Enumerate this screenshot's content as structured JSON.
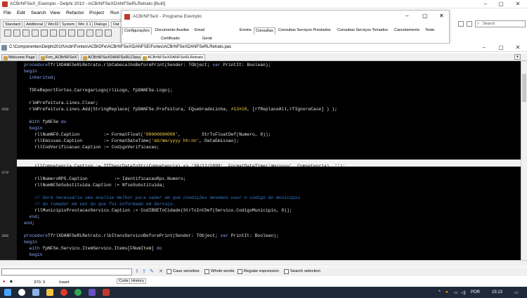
{
  "ide": {
    "title": "ACBrNFSeX_Exemplo - Delphi 2010 - ACBrNFSeXDANFSeRLRetrato [Built]",
    "menu": [
      "File",
      "Edit",
      "Search",
      "View",
      "Refactor",
      "Project",
      "Run"
    ],
    "palette_tabs": [
      "Standard",
      "Additional",
      "Win32",
      "System",
      "Win 3.1",
      "Dialogs",
      "Dat"
    ],
    "search_placeholder": "Search"
  },
  "app_window": {
    "title": "ACBrNFSeX - Programa Exemplo",
    "left_tabs": [
      "Configurações",
      "Documento Auxiliar",
      "Email"
    ],
    "left_subtabs": [
      "Certificado",
      "Geral"
    ],
    "right_tabs": [
      "Envios",
      "Consultas",
      "Consultas Serviços Prestados",
      "Consultas Serviços Tomados",
      "Cancelamento",
      "Teste"
    ]
  },
  "editor": {
    "path": "C:\\Componentes\\Delphi2010\\Acbr\\Fontes\\ACBrDFe\\ACBrNFSeX\\DANFSE\\Fortes\\ACBrNFSeXDANFSeRLRetrato.pas",
    "tabs": [
      "Welcome Page",
      "Frm_ACBrNFSeX",
      "ACBrNFSeXDANFSeRLClass",
      "ACBrNFSeXDANFSeRLRetrato"
    ],
    "active_tab": 3,
    "line_numbers": [
      {
        "n": "360",
        "row": 7
      },
      {
        "n": "370",
        "row": 17
      },
      {
        "n": "380",
        "row": 27
      }
    ],
    "code": [
      {
        "segs": [
          [
            "kw",
            "procedure"
          ],
          [
            "",
            "TfrlXDANFSeRLRetrato.rlbCabecalhoBeforePrint(Sender: TObject; "
          ],
          [
            "kw",
            "var"
          ],
          [
            "",
            " PrintIt: Boolean);"
          ]
        ]
      },
      {
        "segs": [
          [
            "kw",
            "begin"
          ]
        ]
      },
      {
        "segs": [
          [
            "kw",
            "  inherited"
          ],
          [
            "",
            ";"
          ]
        ]
      },
      {
        "segs": []
      },
      {
        "segs": [
          [
            "",
            "  TDFeReportFortes.CarregarLogo(rliLogo, fpDANFSe.Logo);"
          ]
        ]
      },
      {
        "segs": []
      },
      {
        "segs": [
          [
            "",
            "  rlmPrefeitura.Lines.Clear;"
          ]
        ]
      },
      {
        "segs": [
          [
            "",
            "  rlmPrefeitura.Lines.Add(StringReplace( fpDANFSe.Prefeitura, FQuebradeLinha, "
          ],
          [
            "st",
            "#13#10"
          ],
          [
            "",
            ", [rfReplaceAll,rfIgnoreCase] ) );"
          ]
        ]
      },
      {
        "segs": []
      },
      {
        "segs": [
          [
            "kw",
            "  With"
          ],
          [
            "",
            " fpNFSe "
          ],
          [
            "kw",
            "do"
          ]
        ]
      },
      {
        "segs": [
          [
            "kw",
            "  begin"
          ]
        ]
      },
      {
        "segs": [
          [
            "",
            "    rllNumNF0.Caption         := FormatFloat("
          ],
          [
            "st",
            "'00000000000'"
          ],
          [
            "",
            ",        StrToFloatDef(Numero, 0));"
          ]
        ]
      },
      {
        "segs": [
          [
            "",
            "    rllEmissao.Caption        := FormatDateTime("
          ],
          [
            "st",
            "'dd/mm/yyyy hh:nn'"
          ],
          [
            "",
            ", DataEmissao);"
          ]
        ]
      },
      {
        "segs": [
          [
            "",
            "    rllCodVerificacao.Caption := CodigoVerificacao;"
          ]
        ]
      },
      {
        "segs": []
      },
      {
        "segs": []
      },
      {
        "segs": [
          [
            "",
            "    rllCompetencia.Caption := IfThen(DateToStr(Competencia) <> "
          ],
          [
            "st",
            "'30/12/1899'"
          ],
          [
            "",
            ", FormatDateTime("
          ],
          [
            "st",
            "'mm/yyyy'"
          ],
          [
            "",
            ", Competencia), "
          ],
          [
            "st",
            "''"
          ],
          [
            "",
            ");"
          ]
        ]
      },
      {
        "segs": []
      },
      {
        "segs": [
          [
            "",
            "    rllNumeroRPS.Caption          := IdentificacaoRps.Numero;"
          ]
        ]
      },
      {
        "segs": [
          [
            "",
            "    rllNumNFSeSubstituida.Caption := NfseSubstituida;"
          ]
        ]
      },
      {
        "segs": []
      },
      {
        "segs": [
          [
            "cm",
            "    // Será necessário uma analise melhor para saber em que condições devemos usar o código do municipio"
          ]
        ]
      },
      {
        "segs": [
          [
            "cm",
            "    // do tomador em vez do que foi informado em Serviço."
          ]
        ]
      },
      {
        "segs": [
          [
            "",
            "    rllMunicipioPrestacaoServico.Caption := CodIBGEToCidade(StrToIntDef(Servico.CodigoMunicipio, 0));"
          ]
        ]
      },
      {
        "segs": [
          [
            "kw",
            "  end"
          ],
          [
            "",
            ";"
          ]
        ]
      },
      {
        "segs": [
          [
            "kw",
            "end"
          ],
          [
            "",
            ";"
          ]
        ]
      },
      {
        "segs": []
      },
      {
        "segs": [
          [
            "kw",
            "procedure"
          ],
          [
            "",
            "TfrlXDANFSeRLRetrato.rlbItensServicoBeforePrint(Sender: TObject; "
          ],
          [
            "kw",
            "var"
          ],
          [
            "",
            " PrintIt: Boolean);"
          ]
        ]
      },
      {
        "segs": [
          [
            "kw",
            "begin"
          ]
        ]
      },
      {
        "segs": [
          [
            "kw",
            "  with"
          ],
          [
            "",
            " fpNFSe.Servico.ItemServico.Items[FNumItem] "
          ],
          [
            "kw",
            "do"
          ]
        ]
      },
      {
        "segs": [
          [
            "kw",
            "  begin"
          ]
        ]
      }
    ]
  },
  "find_bar": {
    "options": [
      "Case sensitive",
      "Whole words",
      "Regular expression",
      "Search selection"
    ]
  },
  "view_tabs": [
    "Code",
    "History"
  ],
  "status": {
    "cursor": "370:  3",
    "mode": "Insert"
  },
  "taskbar": {
    "lang": "POR",
    "time": "15:13"
  }
}
